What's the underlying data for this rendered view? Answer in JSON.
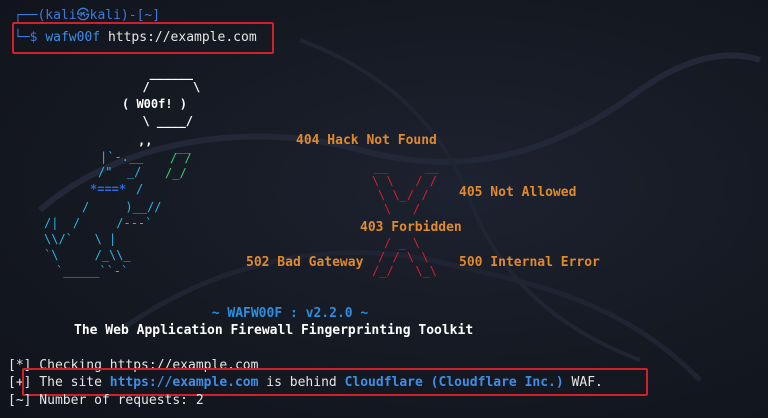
{
  "prompt": {
    "user_host": "┌──(kali㉿kali)-[~]",
    "symbol": "└─$",
    "command": "wafw00f",
    "argument": "https://example.com"
  },
  "banner": {
    "logo_text": "W00f!",
    "errors": {
      "e404": "404 Hack Not Found",
      "e405": "405 Not Allowed",
      "e403": "403 Forbidden",
      "e502": "502 Bad Gateway",
      "e500": "500 Internal Error"
    },
    "version_line": "~ WAFW00F : v2.2.0 ~",
    "tagline": "The Web Application Firewall Fingerprinting Toolkit"
  },
  "output": {
    "checking": "[*] Checking https://example.com",
    "result_prefix": "[+] The site ",
    "result_url": "https://example.com",
    "result_mid": " is behind ",
    "result_waf": "Cloudflare (Cloudflare Inc.)",
    "result_suffix": " WAF.",
    "requests": "[~] Number of requests: 2"
  },
  "colors": {
    "background": "#141822",
    "prompt_blue": "#3b7bd9",
    "error_orange": "#e08a2e",
    "x_red": "#d3202b",
    "highlight_red": "#d0202a"
  }
}
